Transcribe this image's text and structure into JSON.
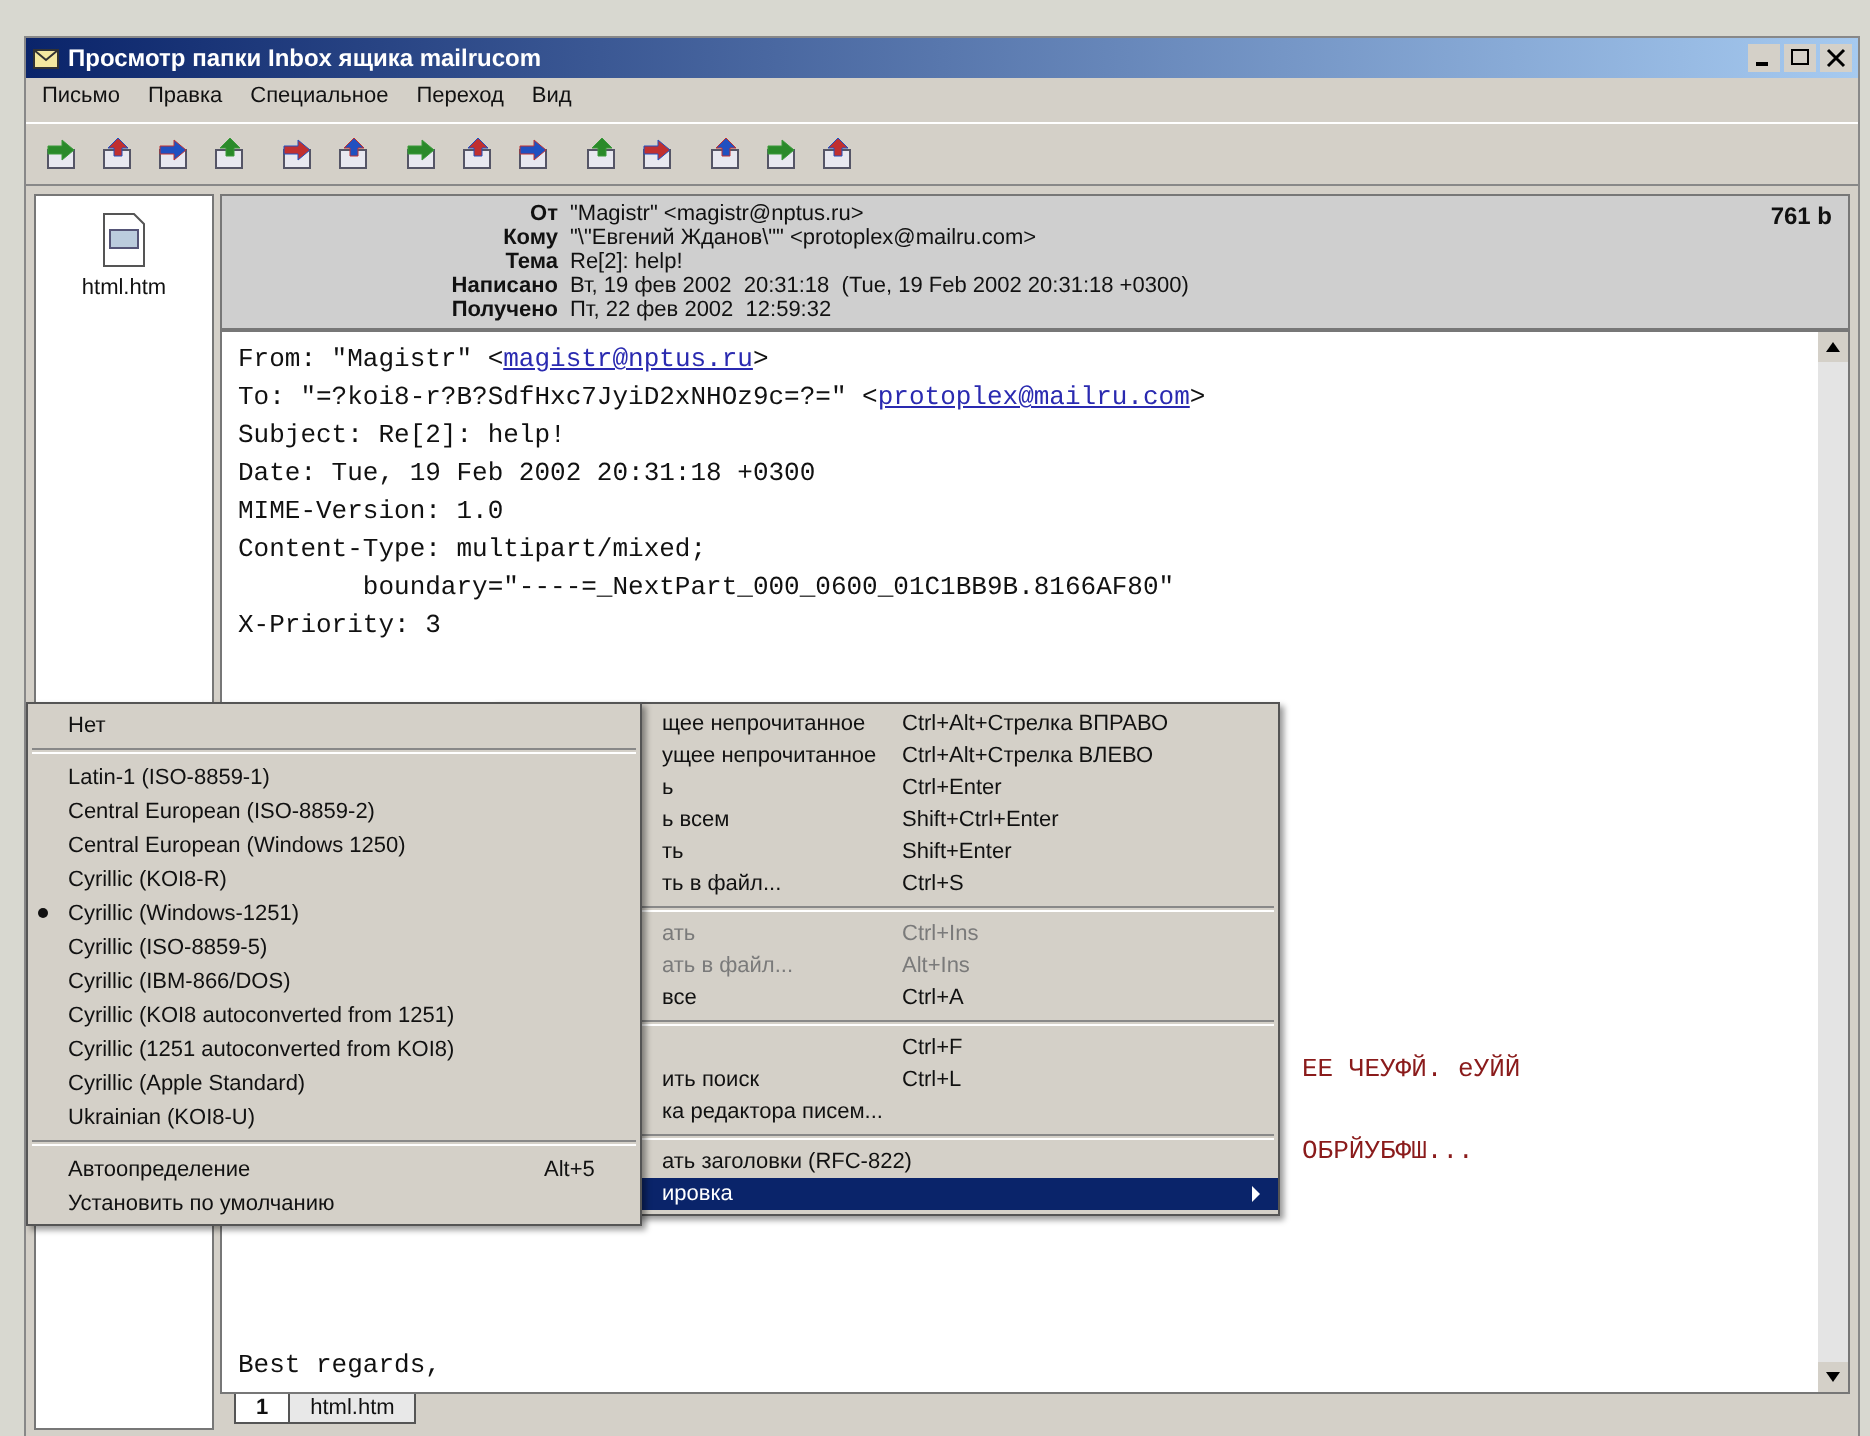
{
  "window": {
    "title": "Просмотр папки Inbox ящика mailrucom"
  },
  "menu_bar": [
    "Письмо",
    "Правка",
    "Специальное",
    "Переход",
    "Вид"
  ],
  "attachments": [
    {
      "name": "html.htm"
    }
  ],
  "header": {
    "size": "761 b",
    "fields": [
      {
        "label": "От",
        "value": "\"Magistr\" <magistr@nptus.ru>"
      },
      {
        "label": "Кому",
        "value": "\"\\\"Евгений Жданов\\\"\" <protoplex@mailru.com>"
      },
      {
        "label": "Тема",
        "value": "Re[2]: help!"
      },
      {
        "label": "Написано",
        "value": "Вт, 19 фев 2002  20:31:18  (Tue, 19 Feb 2002 20:31:18 +0300)"
      },
      {
        "label": "Получено",
        "value": "Пт, 22 фев 2002  12:59:32"
      }
    ]
  },
  "body": {
    "lines": [
      {
        "text": "From: \"Magistr\" <",
        "link": "magistr@nptus.ru",
        "after": ">"
      },
      {
        "text": "To: \"=?koi8-r?B?SdfHxc7JyiD2xNHOz9c=?=\" <",
        "link": "protoplex@mailru.com",
        "after": ">"
      },
      {
        "text": "Subject: Re[2]: help!"
      },
      {
        "text": "Date: Tue, 19 Feb 2002 20:31:18 +0300"
      },
      {
        "text": "MIME-Version: 1.0"
      },
      {
        "text": "Content-Type: multipart/mixed;"
      },
      {
        "text": "        boundary=\"----=_NextPart_000_0600_01C1BB9B.8166AF80\""
      },
      {
        "text": "X-Priority: 3"
      }
    ],
    "fragments": [
      "ЕЕ ЧЕУФЙ. еУЙЙ",
      "ОБРЙУБФШ..."
    ],
    "closing": "Best regards,"
  },
  "context_menu": {
    "items": [
      {
        "kind": "item",
        "label": "щее непрочитанное",
        "shortcut": "Ctrl+Alt+Стрелка ВПРАВО",
        "disabled": false,
        "selected": false
      },
      {
        "kind": "item",
        "label": "ущее непрочитанное",
        "shortcut": "Ctrl+Alt+Стрелка ВЛЕВО",
        "disabled": false,
        "selected": false
      },
      {
        "kind": "item",
        "label": "ь",
        "shortcut": "Ctrl+Enter",
        "disabled": false,
        "selected": false
      },
      {
        "kind": "item",
        "label": "ь всем",
        "shortcut": "Shift+Ctrl+Enter",
        "disabled": false,
        "selected": false
      },
      {
        "kind": "item",
        "label": "ть",
        "shortcut": "Shift+Enter",
        "disabled": false,
        "selected": false
      },
      {
        "kind": "item",
        "label": "ть в файл...",
        "shortcut": "Ctrl+S",
        "disabled": false,
        "selected": false
      },
      {
        "kind": "separator"
      },
      {
        "kind": "item",
        "label": "ать",
        "shortcut": "Ctrl+Ins",
        "disabled": true,
        "selected": false
      },
      {
        "kind": "item",
        "label": "ать в файл...",
        "shortcut": "Alt+Ins",
        "disabled": true,
        "selected": false
      },
      {
        "kind": "item",
        "label": "все",
        "shortcut": "Ctrl+A",
        "disabled": false,
        "selected": false
      },
      {
        "kind": "separator"
      },
      {
        "kind": "item",
        "shortcut": "Ctrl+F",
        "disabled": false,
        "selected": false
      },
      {
        "kind": "item",
        "label": "ить поиск",
        "shortcut": "Ctrl+L",
        "disabled": false,
        "selected": false
      },
      {
        "kind": "item",
        "label": "ка редактора писем...",
        "disabled": false,
        "selected": false
      },
      {
        "kind": "separator"
      },
      {
        "kind": "item",
        "label": "ать заголовки (RFC-822)",
        "disabled": false,
        "selected": false
      },
      {
        "kind": "submenu",
        "label": "ировка",
        "disabled": false,
        "selected": true
      }
    ]
  },
  "encoding_menu": {
    "items": [
      {
        "kind": "item",
        "label": "Нет",
        "checked": false
      },
      {
        "kind": "separator"
      },
      {
        "kind": "item",
        "label": "Latin-1 (ISO-8859-1)",
        "checked": false
      },
      {
        "kind": "item",
        "label": "Central European (ISO-8859-2)",
        "checked": false
      },
      {
        "kind": "item",
        "label": "Central European (Windows 1250)",
        "checked": false
      },
      {
        "kind": "item",
        "label": "Cyrillic (KOI8-R)",
        "checked": false
      },
      {
        "kind": "item",
        "label": "Cyrillic (Windows-1251)",
        "checked": true
      },
      {
        "kind": "item",
        "label": "Cyrillic (ISO-8859-5)",
        "checked": false
      },
      {
        "kind": "item",
        "label": "Cyrillic (IBM-866/DOS)",
        "checked": false
      },
      {
        "kind": "item",
        "label": "Cyrillic (KOI8 autoconverted from 1251)",
        "checked": false
      },
      {
        "kind": "item",
        "label": "Cyrillic (1251 autoconverted from KOI8)",
        "checked": false
      },
      {
        "kind": "item",
        "label": "Cyrillic (Apple Standard)",
        "checked": false
      },
      {
        "kind": "item",
        "label": "Ukrainian (KOI8-U)",
        "checked": false
      },
      {
        "kind": "separator"
      },
      {
        "kind": "item",
        "label": "Автоопределение",
        "shortcut": "Alt+5",
        "checked": false
      },
      {
        "kind": "item",
        "label": "Установить по умолчанию",
        "checked": false
      }
    ]
  },
  "tabs": [
    {
      "label": "1",
      "selected": true
    },
    {
      "label": "html.htm",
      "selected": false
    }
  ]
}
